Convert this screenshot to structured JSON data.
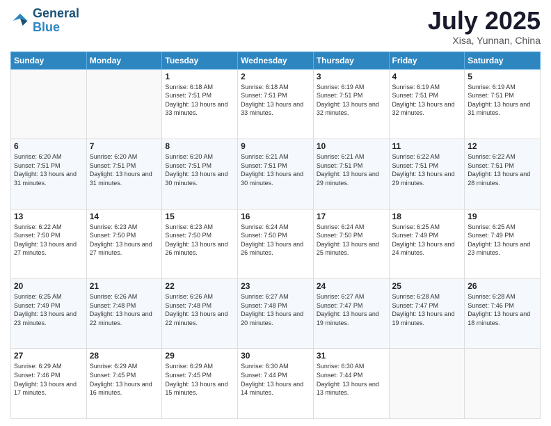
{
  "header": {
    "logo_line1": "General",
    "logo_line2": "Blue",
    "month": "July 2025",
    "location": "Xisa, Yunnan, China"
  },
  "days_of_week": [
    "Sunday",
    "Monday",
    "Tuesday",
    "Wednesday",
    "Thursday",
    "Friday",
    "Saturday"
  ],
  "weeks": [
    [
      {
        "day": "",
        "empty": true
      },
      {
        "day": "",
        "empty": true
      },
      {
        "day": "1",
        "sunrise": "6:18 AM",
        "sunset": "7:51 PM",
        "daylight": "13 hours and 33 minutes."
      },
      {
        "day": "2",
        "sunrise": "6:18 AM",
        "sunset": "7:51 PM",
        "daylight": "13 hours and 33 minutes."
      },
      {
        "day": "3",
        "sunrise": "6:19 AM",
        "sunset": "7:51 PM",
        "daylight": "13 hours and 32 minutes."
      },
      {
        "day": "4",
        "sunrise": "6:19 AM",
        "sunset": "7:51 PM",
        "daylight": "13 hours and 32 minutes."
      },
      {
        "day": "5",
        "sunrise": "6:19 AM",
        "sunset": "7:51 PM",
        "daylight": "13 hours and 31 minutes."
      }
    ],
    [
      {
        "day": "6",
        "sunrise": "6:20 AM",
        "sunset": "7:51 PM",
        "daylight": "13 hours and 31 minutes."
      },
      {
        "day": "7",
        "sunrise": "6:20 AM",
        "sunset": "7:51 PM",
        "daylight": "13 hours and 31 minutes."
      },
      {
        "day": "8",
        "sunrise": "6:20 AM",
        "sunset": "7:51 PM",
        "daylight": "13 hours and 30 minutes."
      },
      {
        "day": "9",
        "sunrise": "6:21 AM",
        "sunset": "7:51 PM",
        "daylight": "13 hours and 30 minutes."
      },
      {
        "day": "10",
        "sunrise": "6:21 AM",
        "sunset": "7:51 PM",
        "daylight": "13 hours and 29 minutes."
      },
      {
        "day": "11",
        "sunrise": "6:22 AM",
        "sunset": "7:51 PM",
        "daylight": "13 hours and 29 minutes."
      },
      {
        "day": "12",
        "sunrise": "6:22 AM",
        "sunset": "7:51 PM",
        "daylight": "13 hours and 28 minutes."
      }
    ],
    [
      {
        "day": "13",
        "sunrise": "6:22 AM",
        "sunset": "7:50 PM",
        "daylight": "13 hours and 27 minutes."
      },
      {
        "day": "14",
        "sunrise": "6:23 AM",
        "sunset": "7:50 PM",
        "daylight": "13 hours and 27 minutes."
      },
      {
        "day": "15",
        "sunrise": "6:23 AM",
        "sunset": "7:50 PM",
        "daylight": "13 hours and 26 minutes."
      },
      {
        "day": "16",
        "sunrise": "6:24 AM",
        "sunset": "7:50 PM",
        "daylight": "13 hours and 26 minutes."
      },
      {
        "day": "17",
        "sunrise": "6:24 AM",
        "sunset": "7:50 PM",
        "daylight": "13 hours and 25 minutes."
      },
      {
        "day": "18",
        "sunrise": "6:25 AM",
        "sunset": "7:49 PM",
        "daylight": "13 hours and 24 minutes."
      },
      {
        "day": "19",
        "sunrise": "6:25 AM",
        "sunset": "7:49 PM",
        "daylight": "13 hours and 23 minutes."
      }
    ],
    [
      {
        "day": "20",
        "sunrise": "6:25 AM",
        "sunset": "7:49 PM",
        "daylight": "13 hours and 23 minutes."
      },
      {
        "day": "21",
        "sunrise": "6:26 AM",
        "sunset": "7:48 PM",
        "daylight": "13 hours and 22 minutes."
      },
      {
        "day": "22",
        "sunrise": "6:26 AM",
        "sunset": "7:48 PM",
        "daylight": "13 hours and 22 minutes."
      },
      {
        "day": "23",
        "sunrise": "6:27 AM",
        "sunset": "7:48 PM",
        "daylight": "13 hours and 20 minutes."
      },
      {
        "day": "24",
        "sunrise": "6:27 AM",
        "sunset": "7:47 PM",
        "daylight": "13 hours and 19 minutes."
      },
      {
        "day": "25",
        "sunrise": "6:28 AM",
        "sunset": "7:47 PM",
        "daylight": "13 hours and 19 minutes."
      },
      {
        "day": "26",
        "sunrise": "6:28 AM",
        "sunset": "7:46 PM",
        "daylight": "13 hours and 18 minutes."
      }
    ],
    [
      {
        "day": "27",
        "sunrise": "6:29 AM",
        "sunset": "7:46 PM",
        "daylight": "13 hours and 17 minutes."
      },
      {
        "day": "28",
        "sunrise": "6:29 AM",
        "sunset": "7:45 PM",
        "daylight": "13 hours and 16 minutes."
      },
      {
        "day": "29",
        "sunrise": "6:29 AM",
        "sunset": "7:45 PM",
        "daylight": "13 hours and 15 minutes."
      },
      {
        "day": "30",
        "sunrise": "6:30 AM",
        "sunset": "7:44 PM",
        "daylight": "13 hours and 14 minutes."
      },
      {
        "day": "31",
        "sunrise": "6:30 AM",
        "sunset": "7:44 PM",
        "daylight": "13 hours and 13 minutes."
      },
      {
        "day": "",
        "empty": true
      },
      {
        "day": "",
        "empty": true
      }
    ]
  ]
}
